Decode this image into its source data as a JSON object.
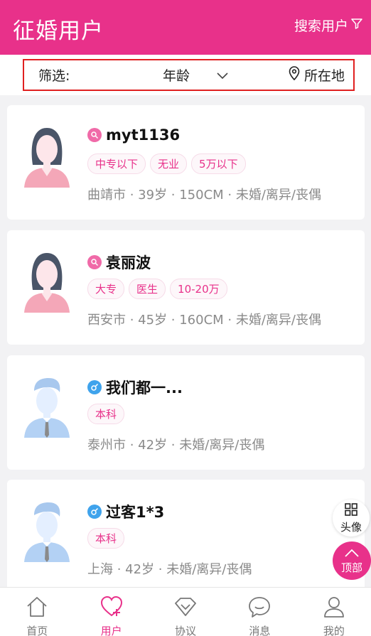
{
  "header": {
    "title": "征婚用户",
    "search_label": "搜索用户"
  },
  "filter": {
    "label": "筛选:",
    "age_label": "年龄",
    "location_label": "所在地"
  },
  "users": [
    {
      "name": "myt1136",
      "gender": "female",
      "tags": [
        "中专以下",
        "无业",
        "5万以下"
      ],
      "info": "曲靖市 · 39岁 · 150CM · 未婚/离异/丧偶"
    },
    {
      "name": "袁丽波",
      "gender": "female",
      "tags": [
        "大专",
        "医生",
        "10-20万"
      ],
      "info": "西安市 · 45岁 · 160CM · 未婚/离异/丧偶"
    },
    {
      "name": "我们都一...",
      "gender": "male",
      "tags": [
        "本科"
      ],
      "info": "泰州市 · 42岁 · 未婚/离异/丧偶"
    },
    {
      "name": "过客1*3",
      "gender": "male",
      "tags": [
        "本科"
      ],
      "info": "上海 · 42岁 · 未婚/离异/丧偶"
    }
  ],
  "float": {
    "avatar_label": "头像",
    "top_label": "顶部"
  },
  "tabs": [
    {
      "label": "首页",
      "icon": "home-icon"
    },
    {
      "label": "用户",
      "icon": "heart-plus-icon"
    },
    {
      "label": "协议",
      "icon": "diamond-icon"
    },
    {
      "label": "消息",
      "icon": "chat-icon"
    },
    {
      "label": "我的",
      "icon": "person-icon"
    }
  ],
  "colors": {
    "brand": "#e8318a",
    "female": "#f06aa8",
    "male": "#3fa3ec"
  }
}
